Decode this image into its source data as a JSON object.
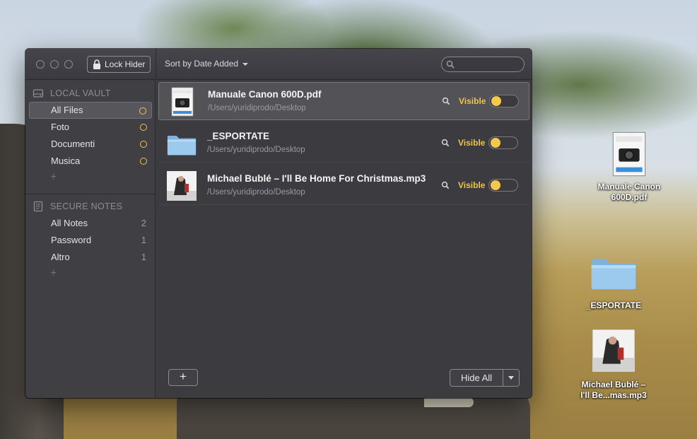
{
  "window": {
    "lock_button_label": "Lock Hider",
    "sort_label": "Sort by Date Added",
    "search_placeholder": ""
  },
  "sidebar": {
    "local_vault": {
      "title": "LOCAL VAULT",
      "items": [
        {
          "label": "All Files",
          "selected": true
        },
        {
          "label": "Foto"
        },
        {
          "label": "Documenti"
        },
        {
          "label": "Musica"
        }
      ]
    },
    "secure_notes": {
      "title": "SECURE NOTES",
      "items": [
        {
          "label": "All Notes",
          "count": "2"
        },
        {
          "label": "Password",
          "count": "1"
        },
        {
          "label": "Altro",
          "count": "1"
        }
      ]
    },
    "plus": "+"
  },
  "files": [
    {
      "name": "Manuale Canon 600D.pdf",
      "path": "/Users/yuridiprodo/Desktop",
      "status": "Visible",
      "thumb": "pdf-thumbnail"
    },
    {
      "name": "_ESPORTATE",
      "path": "/Users/yuridiprodo/Desktop",
      "status": "Visible",
      "thumb": "folder-icon"
    },
    {
      "name": "Michael Bublé – I'll Be Home For Christmas.mp3",
      "path": "/Users/yuridiprodo/Desktop",
      "status": "Visible",
      "thumb": "album-art"
    }
  ],
  "footer": {
    "add_label": "+",
    "hide_all_label": "Hide All"
  },
  "desktop": {
    "icons": [
      {
        "label": "Manuale Canon 600D.pdf",
        "kind": "pdf"
      },
      {
        "label": "_ESPORTATE",
        "kind": "folder"
      },
      {
        "label": "Michael Bublé – I'll Be...mas.mp3",
        "kind": "mp3"
      }
    ]
  },
  "colors": {
    "accent": "#f3c84b",
    "window_bg": "#3b3b40",
    "sidebar_bg": "#3f3f44"
  }
}
